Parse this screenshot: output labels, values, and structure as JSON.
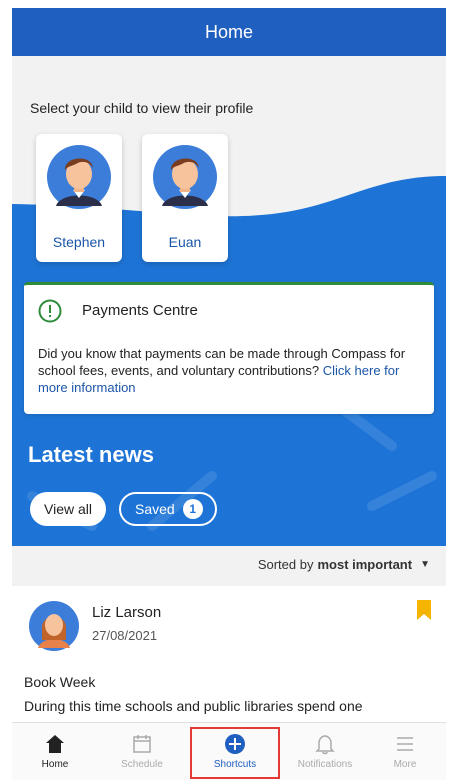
{
  "header": {
    "title": "Home"
  },
  "select_child": {
    "label": "Select your child to view their profile",
    "children": [
      {
        "name": "Stephen"
      },
      {
        "name": "Euan"
      }
    ]
  },
  "payments": {
    "title": "Payments Centre",
    "body": "Did you know that payments can be made through Compass for school fees, events, and voluntary contributions?",
    "link": "Click here for more information",
    "icon": "alert-circle-icon"
  },
  "news": {
    "title": "Latest news",
    "view_all": "View all",
    "saved_label": "Saved",
    "saved_count": "1",
    "sort_prefix": "Sorted by",
    "sort_value": "most important"
  },
  "news_item": {
    "author": "Liz Larson",
    "date": "27/08/2021",
    "headline": "Book Week",
    "excerpt": "During this time schools and public libraries spend one"
  },
  "tabs": [
    {
      "label": "Home",
      "icon": "home-icon"
    },
    {
      "label": "Schedule",
      "icon": "calendar-icon"
    },
    {
      "label": "Shortcuts",
      "icon": "plus-circle-icon"
    },
    {
      "label": "Notifications",
      "icon": "bell-icon"
    },
    {
      "label": "More",
      "icon": "menu-icon"
    }
  ],
  "colors": {
    "primary": "#1f5fbf",
    "hero": "#1e74d6",
    "success": "#2e8b3a",
    "bookmark": "#f5b400",
    "highlight": "#e53935"
  }
}
